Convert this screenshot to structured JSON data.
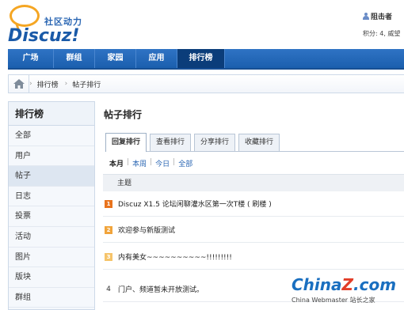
{
  "header": {
    "logo_tagline": "社区动力",
    "logo_word": "Discuz!",
    "user_name": "阻击者",
    "user_stats": "积分: 4, 威望"
  },
  "nav": {
    "items": [
      {
        "label": "广场"
      },
      {
        "label": "群组"
      },
      {
        "label": "家园"
      },
      {
        "label": "应用"
      },
      {
        "label": "排行榜"
      }
    ],
    "active": "排行榜"
  },
  "breadcrumb": {
    "link": "排行榜",
    "separator": "›",
    "current": "帖子排行"
  },
  "sidebar": {
    "title": "排行榜",
    "items": [
      {
        "label": "全部"
      },
      {
        "label": "用户"
      },
      {
        "label": "帖子"
      },
      {
        "label": "日志"
      },
      {
        "label": "投票"
      },
      {
        "label": "活动"
      },
      {
        "label": "图片"
      },
      {
        "label": "版块"
      },
      {
        "label": "群组"
      }
    ],
    "active": "帖子"
  },
  "main": {
    "heading": "帖子排行",
    "tabs": [
      {
        "label": "回复排行"
      },
      {
        "label": "查看排行"
      },
      {
        "label": "分享排行"
      },
      {
        "label": "收藏排行"
      }
    ],
    "active_tab": "回复排行",
    "filters": [
      {
        "label": "本月"
      },
      {
        "label": "本周"
      },
      {
        "label": "今日"
      },
      {
        "label": "全部"
      }
    ],
    "filter_sep": "|",
    "column_header": "主题",
    "rows": [
      {
        "rank": "1",
        "subject": "Discuz X1.5 论坛闲聊灌水区第一次T楼 ( 刷楼 )"
      },
      {
        "rank": "2",
        "subject": "欢迎参与新版测试"
      },
      {
        "rank": "3",
        "subject": "内有美女~~~~~~~~~~!!!!!!!!!"
      },
      {
        "rank": "4",
        "subject": "门户、频道暂未开放测试。"
      }
    ]
  },
  "watermark": {
    "brand_left": "China",
    "brand_z": "Z",
    "brand_right": ".com",
    "sub": "China Webmaster 站长之家"
  },
  "colors": {
    "nav_blue": "#1b5fae",
    "nav_active": "#0b3d7a",
    "link_blue": "#2a66b3",
    "rank1": "#e8731d",
    "rank2": "#f1a43b",
    "rank3": "#f6c46a",
    "logo_orange": "#f5a623"
  }
}
